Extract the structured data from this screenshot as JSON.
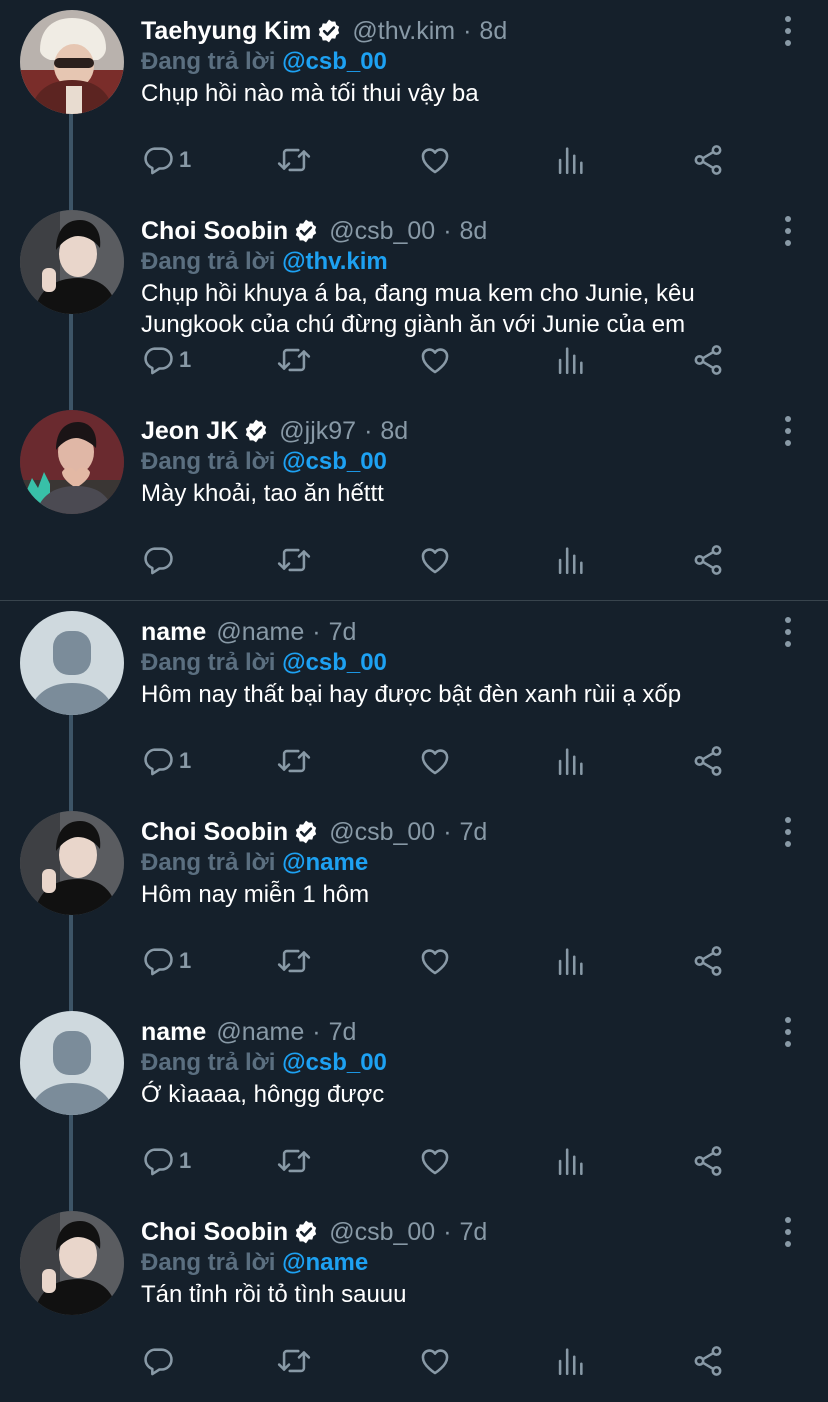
{
  "reply_prefix": "Đang trả lời",
  "groups": [
    {
      "tweets": [
        {
          "name": "Taehyung Kim",
          "verified": true,
          "handle": "@thv.kim",
          "time": "8d",
          "reply_to": "@csb_00",
          "text": "Chụp hồi nào mà tối thui vậy ba",
          "reply_count": "1",
          "avatar": "taehyung-avatar"
        },
        {
          "name": "Choi Soobin",
          "verified": true,
          "handle": "@csb_00",
          "time": "8d",
          "reply_to": "@thv.kim",
          "text": "Chụp hồi khuya á ba, đang mua kem cho Junie, kêu Jungkook của chú đừng giành ăn với Junie của em",
          "reply_count": "1",
          "avatar": "soobin-avatar"
        },
        {
          "name": "Jeon JK",
          "verified": true,
          "handle": "@jjk97",
          "time": "8d",
          "reply_to": "@csb_00",
          "text": "Mày khoải, tao ăn hếttt",
          "reply_count": "",
          "avatar": "jk-avatar"
        }
      ]
    },
    {
      "tweets": [
        {
          "name": "name",
          "verified": false,
          "handle": "@name",
          "time": "7d",
          "reply_to": "@csb_00",
          "text": "Hôm nay thất bại hay được bật đèn xanh rùii ạ xốp",
          "reply_count": "1",
          "avatar": "default-avatar"
        },
        {
          "name": "Choi Soobin",
          "verified": true,
          "handle": "@csb_00",
          "time": "7d",
          "reply_to": "@name",
          "text": "Hôm nay miễn 1 hôm",
          "reply_count": "1",
          "avatar": "soobin-avatar"
        },
        {
          "name": "name",
          "verified": false,
          "handle": "@name",
          "time": "7d",
          "reply_to": "@csb_00",
          "text": "Ớ kìaaaa, hôngg được",
          "reply_count": "1",
          "avatar": "default-avatar"
        },
        {
          "name": "Choi Soobin",
          "verified": true,
          "handle": "@csb_00",
          "time": "7d",
          "reply_to": "@name",
          "text": "Tán tỉnh rồi tỏ tình sauuu",
          "reply_count": "",
          "avatar": "soobin-avatar"
        }
      ]
    }
  ],
  "icons": [
    "reply-icon",
    "retweet-icon",
    "like-icon",
    "analytics-icon",
    "share-icon",
    "more-icon",
    "verified-badge-icon"
  ],
  "colors": {
    "background": "#15202b",
    "secondary_text": "#8899a6",
    "mention": "#1da1f2",
    "thread_line": "#3d5466",
    "divider": "#38444d"
  }
}
